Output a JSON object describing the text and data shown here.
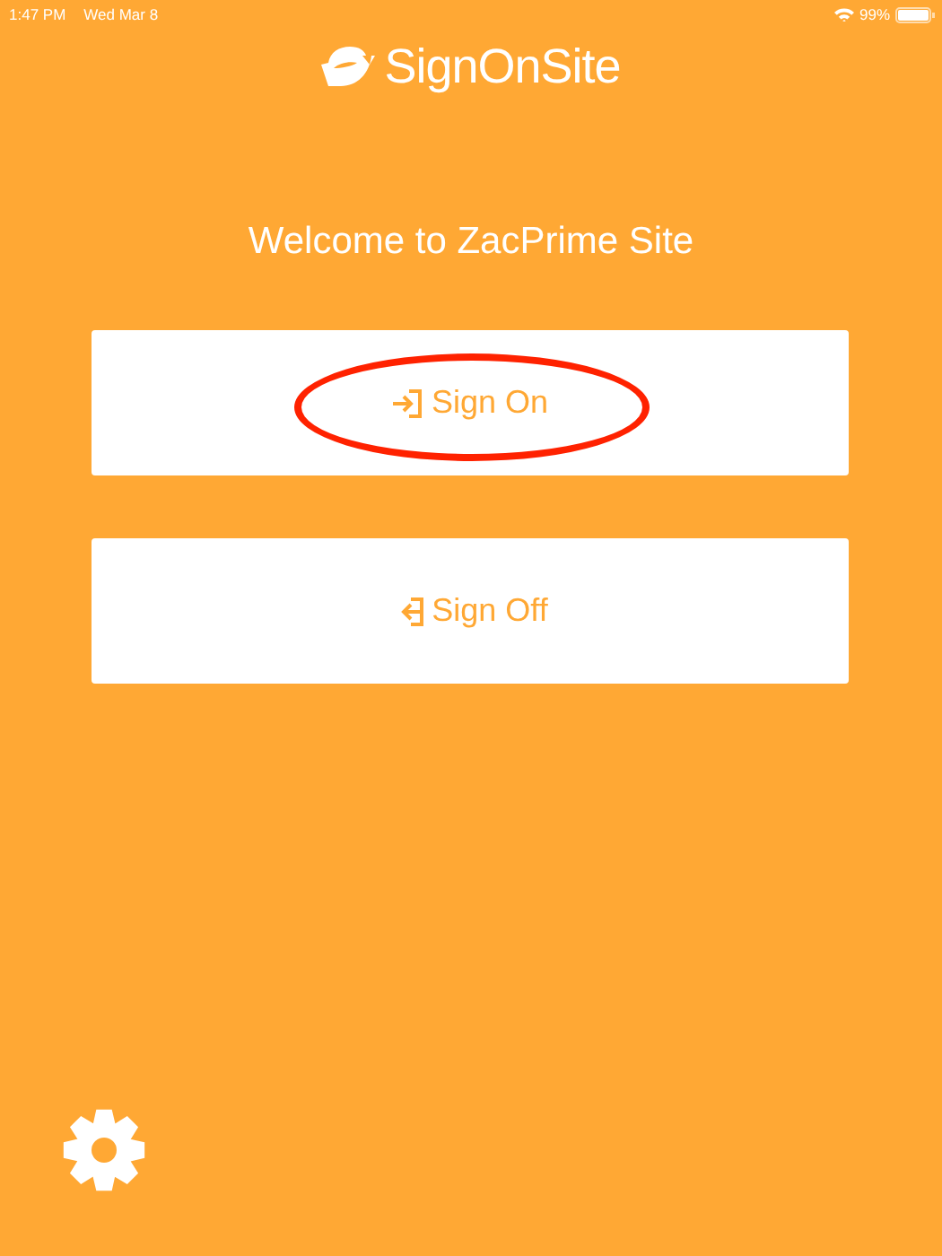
{
  "status_bar": {
    "time": "1:47 PM",
    "date": "Wed Mar 8",
    "battery": "99%"
  },
  "brand": {
    "name": "SignOnSite"
  },
  "welcome": "Welcome to ZacPrime Site",
  "actions": [
    {
      "kind": "sign-on",
      "label": "Sign On",
      "highlighted": true
    },
    {
      "kind": "sign-off",
      "label": "Sign Off",
      "highlighted": false
    }
  ]
}
